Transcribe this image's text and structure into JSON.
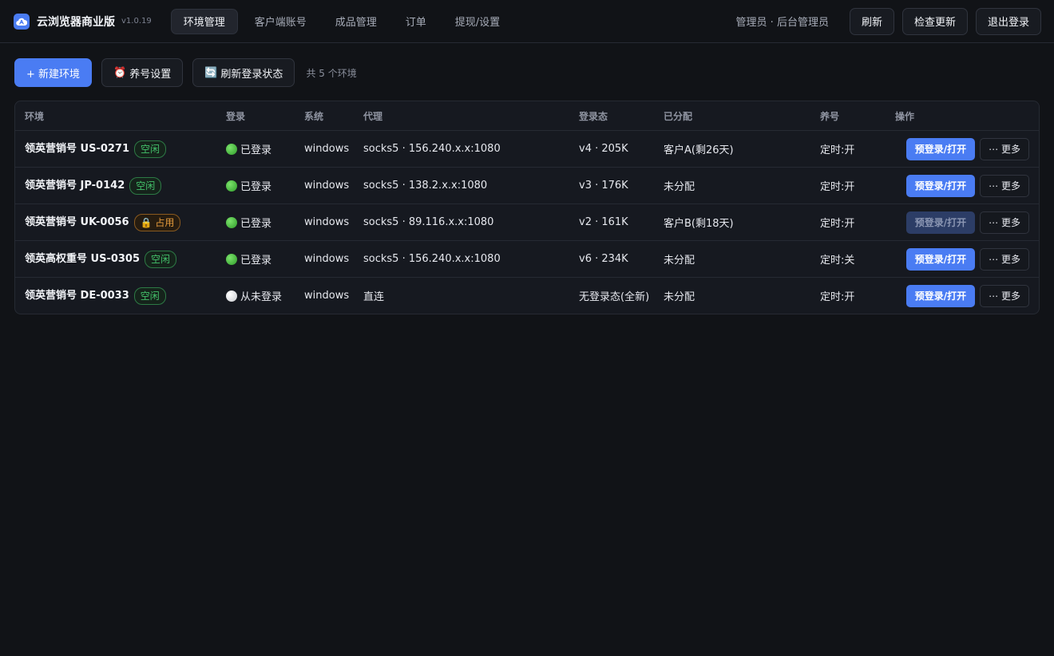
{
  "app": {
    "name": "云浏览器商业版",
    "version": "v1.0.19",
    "accent": "#4a7cf3"
  },
  "nav": {
    "tabs": [
      "环境管理",
      "客户端账号",
      "成品管理",
      "订单",
      "提现/设置"
    ],
    "active": "环境管理"
  },
  "header": {
    "user": "管理员 · 后台管理员",
    "refresh": "刷新",
    "check_update": "检查更新",
    "logout": "退出登录"
  },
  "toolbar": {
    "new_env": "+ 新建环境",
    "nurture_icon": "⏰",
    "nurture": "养号设置",
    "refresh_login_icon": "🔄",
    "refresh_login": "刷新登录状态",
    "count": "共 5 个环境"
  },
  "table": {
    "headers": [
      "环境",
      "登录",
      "系统",
      "代理",
      "登录态",
      "已分配",
      "养号",
      "操作"
    ],
    "rows": [
      {
        "name": "领英营销号 US-0271",
        "tag": "空闲",
        "tag_type": "free",
        "login": "已登录",
        "login_state": "green",
        "os": "windows",
        "proxy": "socks5 · 156.240.x.x:1080",
        "session": "v4 · 205K",
        "assigned": "客户A(剩26天)",
        "nurture": "定时:开",
        "open": "预登录/打开",
        "open_disabled": false,
        "more": "⋯ 更多"
      },
      {
        "name": "领英营销号 JP-0142",
        "tag": "空闲",
        "tag_type": "free",
        "login": "已登录",
        "login_state": "green",
        "os": "windows",
        "proxy": "socks5 · 138.2.x.x:1080",
        "session": "v3 · 176K",
        "assigned": "未分配",
        "nurture": "定时:开",
        "open": "预登录/打开",
        "open_disabled": false,
        "more": "⋯ 更多"
      },
      {
        "name": "领英营销号 UK-0056",
        "tag": "🔒 占用",
        "tag_type": "busy",
        "login": "已登录",
        "login_state": "green",
        "os": "windows",
        "proxy": "socks5 · 89.116.x.x:1080",
        "session": "v2 · 161K",
        "assigned": "客户B(剩18天)",
        "nurture": "定时:开",
        "open": "预登录/打开",
        "open_disabled": true,
        "more": "⋯ 更多"
      },
      {
        "name": "领英高权重号 US-0305",
        "tag": "空闲",
        "tag_type": "free",
        "login": "已登录",
        "login_state": "green",
        "os": "windows",
        "proxy": "socks5 · 156.240.x.x:1080",
        "session": "v6 · 234K",
        "assigned": "未分配",
        "nurture": "定时:关",
        "open": "预登录/打开",
        "open_disabled": false,
        "more": "⋯ 更多"
      },
      {
        "name": "领英营销号 DE-0033",
        "tag": "空闲",
        "tag_type": "free",
        "login": "从未登录",
        "login_state": "grey",
        "os": "windows",
        "proxy": "直连",
        "session": "无登录态(全新)",
        "assigned": "未分配",
        "nurture": "定时:开",
        "open": "预登录/打开",
        "open_disabled": false,
        "more": "⋯ 更多"
      }
    ]
  }
}
